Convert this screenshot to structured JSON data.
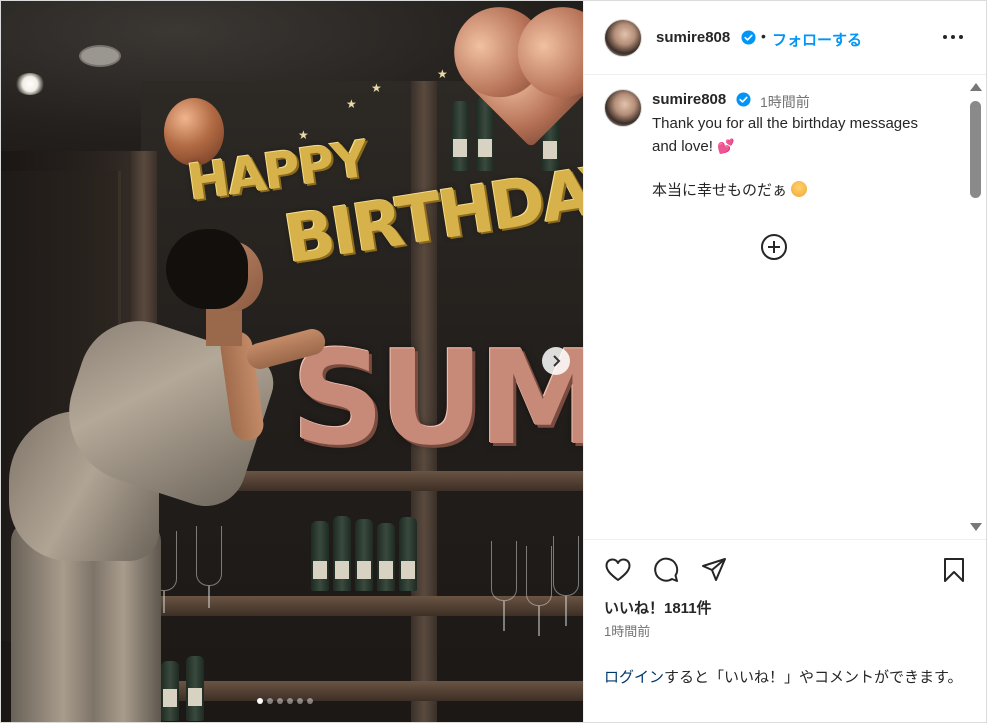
{
  "post": {
    "username": "sumire808",
    "follow_label": "フォローする",
    "separator": "•",
    "more_label": "More options"
  },
  "caption": {
    "username": "sumire808",
    "time": "1時間前",
    "line1": "Thank you for all the birthday messages and love!",
    "line1_emoji": "💕",
    "line2": "本当に幸せものだぁ"
  },
  "photo": {
    "balloon_happy": "HAPPY",
    "balloon_birthday": "BIRTHDAY",
    "balloon_sum": "SUM",
    "carousel_count": 6,
    "carousel_active_index": 0
  },
  "engagement": {
    "likes": "いいね！1811件",
    "posted_time": "1時間前"
  },
  "login_prompt": {
    "link": "ログイン",
    "text": "すると「いいね！」やコメントができます。"
  },
  "colors": {
    "accent": "#0095f6",
    "link": "#00376b",
    "verified": "#0095f6",
    "muted": "#737373"
  },
  "icons": [
    "verified-icon",
    "more-icon",
    "add-comment-icon",
    "heart-icon",
    "comment-icon",
    "share-icon",
    "bookmark-icon",
    "chevron-right-icon"
  ]
}
